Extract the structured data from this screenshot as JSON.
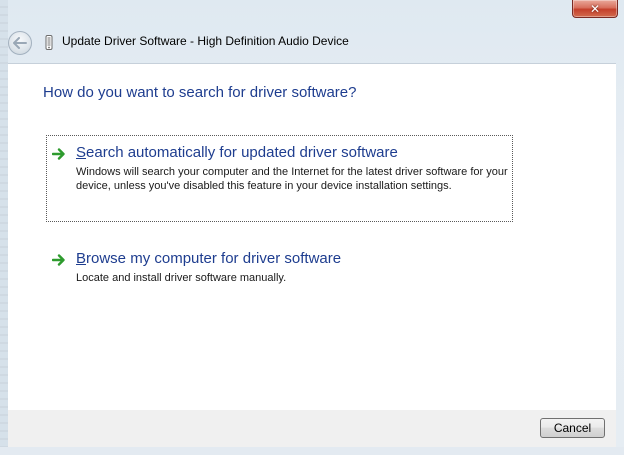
{
  "window": {
    "title": "Update Driver Software - High Definition Audio Device",
    "close_glyph": "✕"
  },
  "colors": {
    "heading": "#1e3d8f",
    "close_button": "#c4402b",
    "arrow": "#2e9b2e"
  },
  "icons": {
    "back": "back-arrow-icon",
    "device": "audio-device-icon",
    "option": "green-arrow-icon"
  },
  "main": {
    "heading": "How do you want to search for driver software?",
    "options": [
      {
        "title_first": "S",
        "title_rest": "earch automatically for updated driver software",
        "description": "Windows will search your computer and the Internet for the latest driver software for your device, unless you've disabled this feature in your device installation settings."
      },
      {
        "title_first": "B",
        "title_rest": "rowse my computer for driver software",
        "description": "Locate and install driver software manually."
      }
    ]
  },
  "footer": {
    "cancel_label": "Cancel"
  }
}
